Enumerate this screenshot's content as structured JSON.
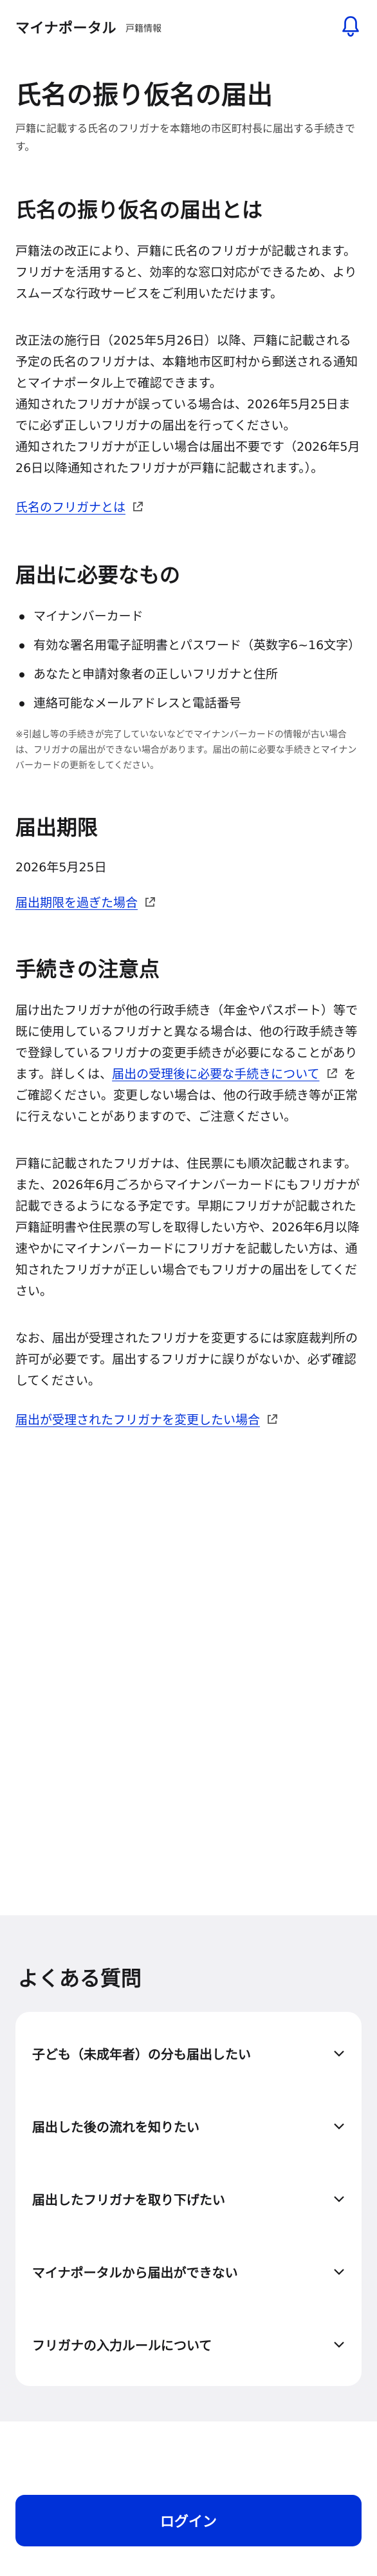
{
  "header": {
    "title": "マイナポータル",
    "subtitle": "戸籍情報",
    "notification_icon": "bell-icon"
  },
  "page": {
    "title": "氏名の振り仮名の届出",
    "lead": "戸籍に記載する氏名のフリガナを本籍地の市区町村長に届出する手続きです。"
  },
  "about": {
    "heading": "氏名の振り仮名の届出とは",
    "p1": "戸籍法の改正により、戸籍に氏名のフリガナが記載されます。フリガナを活用すると、効率的な窓口対応ができるため、よりスムーズな行政サービスをご利用いただけます。",
    "p2": "改正法の施行日（2025年5月26日）以降、戸籍に記載される予定の氏名のフリガナは、本籍地市区町村から郵送される通知とマイナポータル上で確認できます。",
    "p3": "通知されたフリガナが誤っている場合は、2026年5月25日までに必ず正しいフリガナの届出を行ってください。",
    "p4": "通知されたフリガナが正しい場合は届出不要です（2026年5月26日以降通知されたフリガナが戸籍に記載されます。）。",
    "link": "氏名のフリガナとは"
  },
  "requirements": {
    "heading": "届出に必要なもの",
    "items": [
      "マイナンバーカード",
      "有効な署名用電子証明書とパスワード（英数字6~16文字）",
      "あなたと申請対象者の正しいフリガナと住所",
      "連絡可能なメールアドレスと電話番号"
    ],
    "note": "※引越し等の手続きが完了していないなどでマイナンバーカードの情報が古い場合は、フリガナの届出ができない場合があります。届出の前に必要な手続きとマイナンバーカードの更新をしてください。"
  },
  "deadline": {
    "heading": "届出期限",
    "date": "2026年5月25日",
    "link": "届出期限を過ぎた場合"
  },
  "cautions": {
    "heading": "手続きの注意点",
    "p1_before": "届け出たフリガナが他の行政手続き（年金やパスポート）等で既に使用しているフリガナと異なる場合は、他の行政手続き等で登録しているフリガナの変更手続きが必要になることがあります。詳しくは、",
    "p1_link": "届出の受理後に必要な手続きについて",
    "p1_after": "をご確認ください。変更しない場合は、他の行政手続き等が正常に行えないことがありますので、ご注意ください。",
    "p2": "戸籍に記載されたフリガナは、住民票にも順次記載されます。また、2026年6月ごろからマイナンバーカードにもフリガナが記載できるようになる予定です。早期にフリガナが記載された戸籍証明書や住民票の写しを取得したい方や、2026年6月以降速やかにマイナンバーカードにフリガナを記載したい方は、通知されたフリガナが正しい場合でもフリガナの届出をしてください。",
    "p3": "なお、届出が受理されたフリガナを変更するには家庭裁判所の許可が必要です。届出するフリガナに誤りがないか、必ず確認してください。",
    "link": "届出が受理されたフリガナを変更したい場合"
  },
  "faq": {
    "heading": "よくある質問",
    "items": [
      "子ども（未成年者）の分も届出したい",
      "届出した後の流れを知りたい",
      "届出したフリガナを取り下げたい",
      "マイナポータルから届出ができない",
      "フリガナの入力ルールについて"
    ]
  },
  "footer": {
    "login_label": "ログイン"
  },
  "colors": {
    "link": "#0031d8",
    "button": "#0031d8",
    "faq_background": "#f1f1f4"
  }
}
